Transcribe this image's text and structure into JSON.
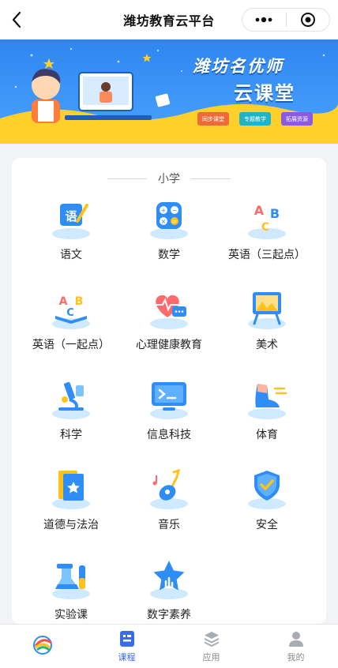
{
  "header": {
    "title": "潍坊教育云平台"
  },
  "banner": {
    "title_line1": "潍坊名优师",
    "title_line2": "云课堂",
    "tags": [
      "同步课堂",
      "专题教学",
      "拓展资源"
    ]
  },
  "section": {
    "title": "小学"
  },
  "subjects": [
    {
      "label": "语文",
      "icon": "chinese-icon"
    },
    {
      "label": "数学",
      "icon": "math-icon"
    },
    {
      "label": "英语（三起点）",
      "icon": "english-abc-icon"
    },
    {
      "label": "英语（一起点）",
      "icon": "english-abc-book-icon"
    },
    {
      "label": "心理健康教育",
      "icon": "heart-chat-icon"
    },
    {
      "label": "美术",
      "icon": "painting-easel-icon"
    },
    {
      "label": "科学",
      "icon": "microscope-icon"
    },
    {
      "label": "信息科技",
      "icon": "monitor-terminal-icon"
    },
    {
      "label": "体育",
      "icon": "running-shoe-icon"
    },
    {
      "label": "道德与法治",
      "icon": "book-star-icon"
    },
    {
      "label": "音乐",
      "icon": "guitar-icon"
    },
    {
      "label": "安全",
      "icon": "shield-check-icon"
    },
    {
      "label": "实验课",
      "icon": "flask-icon"
    },
    {
      "label": "数字素养",
      "icon": "star-icon"
    }
  ],
  "tabs": [
    {
      "label": "",
      "icon": "app-logo-icon",
      "active": false
    },
    {
      "label": "课程",
      "icon": "course-icon",
      "active": true
    },
    {
      "label": "应用",
      "icon": "layers-icon",
      "active": false
    },
    {
      "label": "我的",
      "icon": "user-icon",
      "active": false
    }
  ],
  "colors": {
    "accent": "#3a6ce8",
    "banner_blue": "#2f86f0",
    "banner_yellow": "#ffd02a"
  }
}
